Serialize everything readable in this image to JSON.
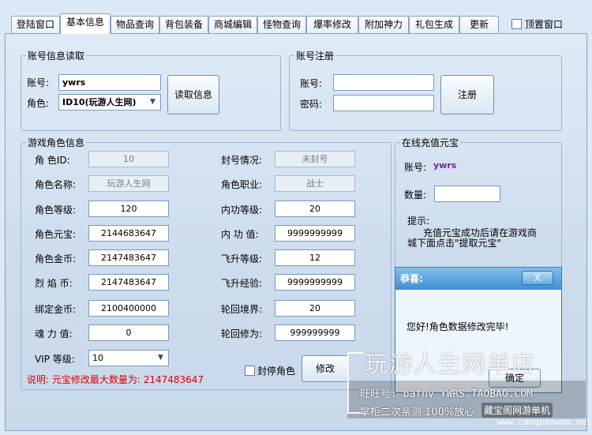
{
  "tabs": [
    {
      "label": "登陆窗口",
      "active": false
    },
    {
      "label": "基本信息",
      "active": true
    },
    {
      "label": "物品查询",
      "active": false
    },
    {
      "label": "背包装备",
      "active": false
    },
    {
      "label": "商城编辑",
      "active": false
    },
    {
      "label": "怪物查询",
      "active": false
    },
    {
      "label": "爆率修改",
      "active": false
    },
    {
      "label": "附加神力",
      "active": false
    },
    {
      "label": "礼包生成",
      "active": false
    },
    {
      "label": "更新",
      "active": false
    }
  ],
  "topmost_label": "顶置窗口",
  "account_read": {
    "legend": "账号信息读取",
    "account_label": "账号:",
    "account_value": "ywrs",
    "role_label": "角色:",
    "role_value": "ID10(玩游人生网)",
    "read_button": "读取信息"
  },
  "account_register": {
    "legend": "账号注册",
    "account_label": "账号:",
    "password_label": "密码:",
    "register_button": "注册"
  },
  "role_info": {
    "legend": "游戏角色信息",
    "left": [
      {
        "label": "角  色ID:",
        "value": "10",
        "disabled": true
      },
      {
        "label": "角色名称:",
        "value": "玩游人生网",
        "disabled": true
      },
      {
        "label": "角色等级:",
        "value": "120",
        "disabled": false
      },
      {
        "label": "角色元宝:",
        "value": "2144683647",
        "disabled": false
      },
      {
        "label": "角色金币:",
        "value": "2147483647",
        "disabled": false
      },
      {
        "label": "烈 焰 币:",
        "value": "2147483647",
        "disabled": false
      },
      {
        "label": "绑定金币:",
        "value": "2100400000",
        "disabled": false
      },
      {
        "label": "魂 力 值:",
        "value": "0",
        "disabled": false
      }
    ],
    "right": [
      {
        "label": "封号情况:",
        "value": "未封号",
        "disabled": true
      },
      {
        "label": "角色职业:",
        "value": "战士",
        "disabled": true
      },
      {
        "label": "内功等级:",
        "value": "20",
        "disabled": false
      },
      {
        "label": "内 功 值:",
        "value": "9999999999",
        "disabled": false
      },
      {
        "label": "飞升等级:",
        "value": "12",
        "disabled": false
      },
      {
        "label": "飞升经验:",
        "value": "9999999999",
        "disabled": false
      },
      {
        "label": "轮回境界:",
        "value": "20",
        "disabled": false
      },
      {
        "label": "轮回修为:",
        "value": "999999999",
        "disabled": false
      }
    ],
    "vip_label": "VIP 等级:",
    "vip_value": "10",
    "ban_label": "封停角色",
    "modify_button": "修改",
    "note": "说明: 元宝修改最大数量为: 2147483647"
  },
  "recharge": {
    "legend": "在线充值元宝",
    "account_label": "账号:",
    "account_value": "ywrs",
    "amount_label": "数量:",
    "hint_title": "提示:",
    "hint_line1": "充值元宝成功后请在游戏商",
    "hint_line2": "城下面点击\"提取元宝\""
  },
  "dialog": {
    "title": "恭喜:",
    "close_label": "X",
    "message": "您好!角色数据修改完毕!",
    "ok_button": "确定"
  },
  "watermark": {
    "title": "玩游人生网单店",
    "wangwang": "旺旺号: bafnv   YWRS.TAOBAO.COM",
    "line2": "掌柜二次亲测 100%放心",
    "logo": "藏宝阁网游单机",
    "site": "www.cangbaowan.net"
  },
  "colors": {
    "background": "#dbe8f5",
    "note_red": "#e00000",
    "account_purple": "#7a1fa2",
    "dialog_title": "#3f8fd0"
  }
}
